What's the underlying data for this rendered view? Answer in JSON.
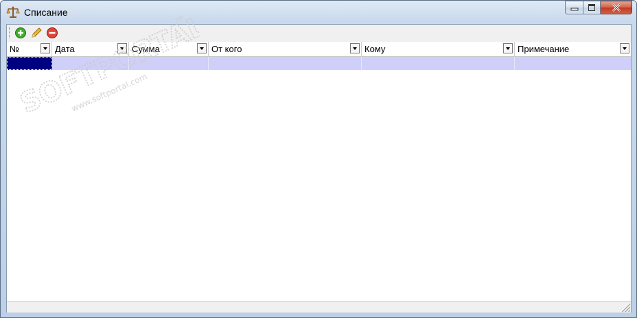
{
  "window": {
    "title": "Списание",
    "minimize_icon": "minimize-icon",
    "maximize_icon": "maximize-icon",
    "close_icon": "close-icon"
  },
  "toolbar": {
    "buttons": [
      {
        "name": "add-button",
        "icon": "plus-circle-icon",
        "color": "#2e9c1e"
      },
      {
        "name": "edit-button",
        "icon": "pencil-icon",
        "color": "#e0a21a"
      },
      {
        "name": "delete-button",
        "icon": "minus-circle-icon",
        "color": "#d0302a"
      }
    ]
  },
  "grid": {
    "columns": [
      "№",
      "Дата",
      "Сумма",
      "От кого",
      "Кому",
      "Примечание"
    ],
    "rows": [
      [
        "",
        "",
        "",
        "",
        "",
        ""
      ]
    ],
    "selected_row_color": "#cfcff9",
    "focused_cell_color": "#000080"
  },
  "watermark": {
    "text": "SOFTPORTAL",
    "url": "www.softportal.com",
    "tm": "TM"
  }
}
